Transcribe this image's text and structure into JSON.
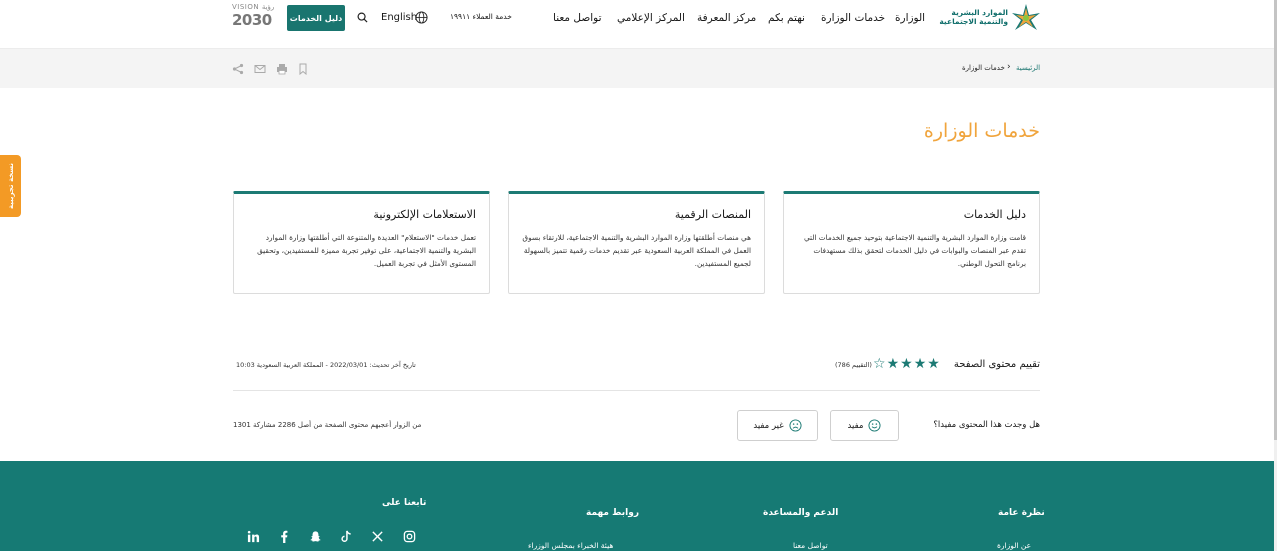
{
  "header": {
    "logo_line1": "الموارد البشرية",
    "logo_line2": "والتنمية الاجتماعية",
    "nav": [
      "الوزارة",
      "خدمات الوزارة",
      "نهتم بكم",
      "مركز المعرفة",
      "المركز الإعلامي",
      "تواصل معنا"
    ],
    "hotline": "خدمة العملاء ١٩٩١١",
    "language": "English",
    "guide_button": "دليل الخدمات",
    "vision_top": "VISION رؤية",
    "vision_year": "2030"
  },
  "breadcrumb": {
    "home": "الرئيسية",
    "separator": "›",
    "current": "خدمات الوزارة"
  },
  "page": {
    "title": "خدمات الوزارة"
  },
  "cards": [
    {
      "title": "دليل الخدمات",
      "desc": "قامت وزارة الموارد البشرية والتنمية الاجتماعية بتوحيد جميع الخدمات التي تقدم عبر المنصات والبوابات في دليل الخدمات لتحقق بذلك مستهدفات برنامج التحول الوطني."
    },
    {
      "title": "المنصات الرقمية",
      "desc": "هي منصات أطلقتها وزارة الموارد البشرية والتنمية الاجتماعية، للارتقاء بسوق العمل في المملكة العربية السعودية عبر تقديم خدمات رقمية تتميز بالسهولة لجميع المستفيدين."
    },
    {
      "title": "الاستعلامات الإلكترونية",
      "desc": "تعمل خدمات \"الاستعلام\" العديدة والمتنوعة التي أطلقتها وزارة الموارد البشرية والتنمية الاجتماعية، على توفير تجربة مميزة للمستفيدين، وتحقيق المستوى الأمثل في تجربة العميل."
    }
  ],
  "rating": {
    "label": "تقييم محتوى الصفحة",
    "stars_filled": 4,
    "stars_total": 5,
    "count_text": "(التقييم 786)",
    "updated_text": "تاريخ آخر تحديث: 2022/03/01 - المملكة العربية السعودية 10:03"
  },
  "feedback": {
    "question": "هل وجدت هذا المحتوى مفيدا؟",
    "useful": "مفيد",
    "not_useful": "غير مفيد",
    "stats": "1301 من الزوار أعجبهم محتوى الصفحة من أصل 2286 مشاركة"
  },
  "footer": {
    "col1_title": "نظرة عامة",
    "col1_link": "عن الوزارة",
    "col2_title": "الدعم والمساعدة",
    "col2_link": "تواصل معنا",
    "col3_title": "روابط مهمة",
    "col3_link": "هيئة الخبراء بمجلس الوزراء",
    "social_title": "تابعنا على",
    "social": [
      "instagram-icon",
      "x-icon",
      "tiktok-icon",
      "snapchat-icon",
      "facebook-icon",
      "linkedin-icon"
    ]
  },
  "side_tab": "نسخة تجريبية",
  "colors": {
    "brand_teal": "#19756f",
    "accent_orange": "#f0a43c",
    "footer_bg": "#167a74"
  }
}
